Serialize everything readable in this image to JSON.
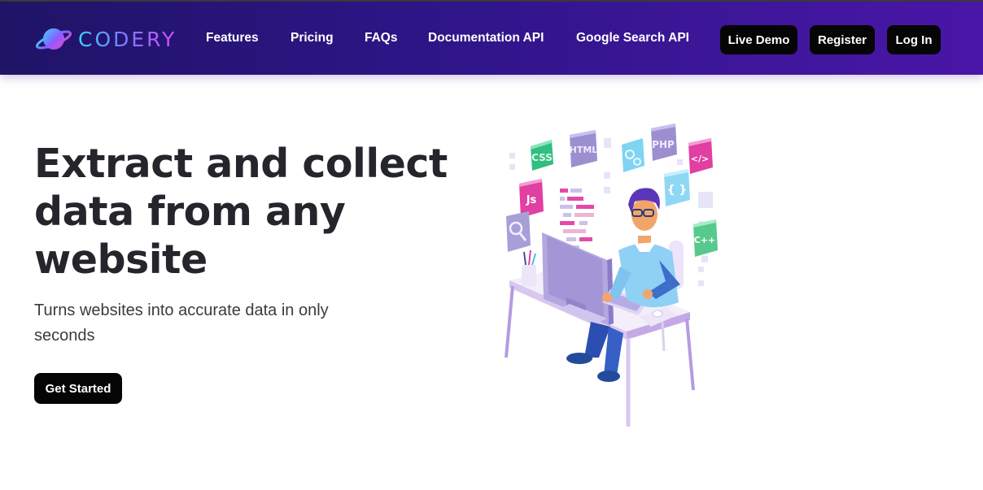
{
  "brand": {
    "name": "CODERY",
    "colors": {
      "nav_start": "#1f1466",
      "nav_end": "#4a16a8",
      "button": "#050505",
      "heading": "#25262b"
    }
  },
  "nav": {
    "links": [
      "Features",
      "Pricing",
      "FAQs",
      "Documentation API",
      "Google Search API"
    ],
    "buttons": [
      "Live Demo",
      "Register",
      "Log In"
    ]
  },
  "hero": {
    "title_lines": [
      "Extract and collect",
      "data from any",
      "website"
    ],
    "subtitle_lines": [
      "Turns websites into accurate data in only",
      "seconds"
    ],
    "cta_label": "Get Started"
  },
  "illustration": {
    "tiles": [
      "CSS",
      "HTML",
      "PHP",
      "</>",
      "Js",
      "{ }",
      "C++"
    ]
  }
}
